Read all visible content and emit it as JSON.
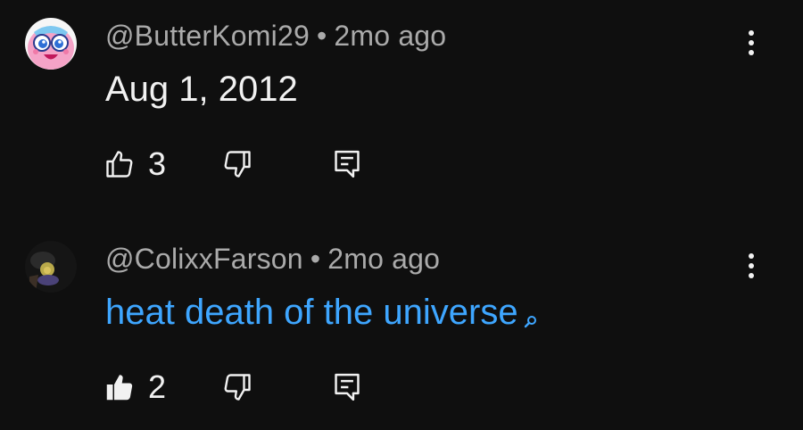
{
  "comments": [
    {
      "handle": "@ButterKomi29",
      "separator": "•",
      "time": "2mo ago",
      "text": "Aug 1, 2012",
      "likes": "3",
      "liked": false,
      "avatar_icon": "pink-cartoon-avatar-icon"
    },
    {
      "handle": "@ColixxFarson",
      "separator": "•",
      "time": "2mo ago",
      "text": "heat death of the universe",
      "text_is_search_link": true,
      "likes": "2",
      "liked": true,
      "avatar_icon": "dark-photo-avatar-icon"
    }
  ],
  "colors": {
    "background": "#0f0f0f",
    "primary_text": "#f1f1f1",
    "secondary_text": "#aaaaaa",
    "link": "#3ea6ff"
  }
}
